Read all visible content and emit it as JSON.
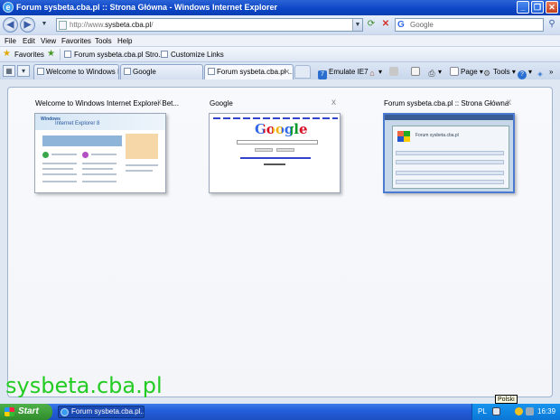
{
  "window": {
    "title": "Forum sysbeta.cba.pl :: Strona Główna - Windows Internet Explorer",
    "controls": [
      "minimize",
      "maximize",
      "close"
    ]
  },
  "address_bar": {
    "url_prefix": "http://www.",
    "url_domain": "sysbeta.cba.pl",
    "url_suffix": "/",
    "search_placeholder": "Google"
  },
  "menu": [
    "File",
    "Edit",
    "View",
    "Favorites",
    "Tools",
    "Help"
  ],
  "favorites_bar": {
    "label": "Favorites",
    "links": [
      "Forum sysbeta.cba.pl Stro...",
      "Customize Links"
    ]
  },
  "tabs": [
    {
      "label": "Welcome to Windows Inte...",
      "active": false
    },
    {
      "label": "Google",
      "active": false
    },
    {
      "label": "Forum sysbeta.cba.pl ...",
      "active": true
    }
  ],
  "command_bar": {
    "emulate": "Emulate IE7",
    "page": "Page",
    "tools": "Tools"
  },
  "quick_tabs": [
    {
      "title": "Welcome to Windows Internet Explorer Bet...",
      "close": "x"
    },
    {
      "title": "Google",
      "close": "x"
    },
    {
      "title": "Forum sysbeta.cba.pl :: Strona Główna",
      "close": "x"
    }
  ],
  "thumbnails": {
    "google_logo": "Google",
    "ie_logo_small": "Windows",
    "ie_logo": "Internet Explorer 8",
    "forum_heading": "Forum sysbeta.cba.pl"
  },
  "watermark": "sysbeta.cba.pl",
  "taskbar": {
    "start": "Start",
    "task": "Forum sysbeta.cba.pl...",
    "lang": "PL",
    "tooltip": "Polski",
    "clock": "16:39"
  },
  "colors": {
    "titlebar": "#0c45c4",
    "watermark": "#22cc22",
    "taskbar": "#245edb",
    "start": "#3a9a36"
  }
}
